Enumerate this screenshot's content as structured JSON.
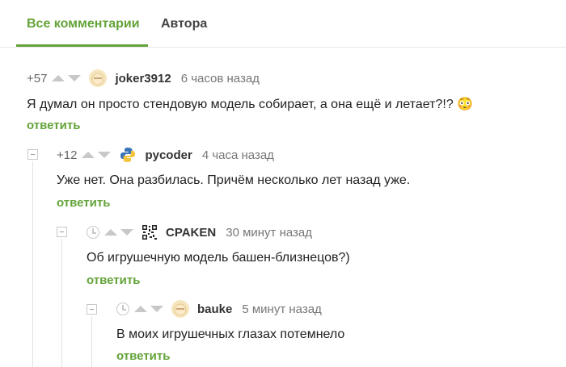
{
  "tabs": {
    "all": "Все комментарии",
    "authors": "Автора"
  },
  "accent_color": "#63a339",
  "comments": [
    {
      "rating": "+57",
      "username": "joker3912",
      "time": "6 часов назад",
      "text": "Я думал он просто стендовую модель собирает, а она ещё и летает?!? 😳",
      "reply": "ответить",
      "avatar_icon": "face-avatar-icon"
    },
    {
      "rating": "+12",
      "username": "pycoder",
      "time": "4 часа назад",
      "text": "Уже нет. Она разбилась. Причём несколько лет назад уже.",
      "reply": "ответить",
      "avatar_icon": "python-logo-icon"
    },
    {
      "username": "CPAKEN",
      "time": "30 минут назад",
      "text": "Об игрушечную модель башен-близнецов?)",
      "reply": "ответить",
      "avatar_icon": "qr-avatar-icon"
    },
    {
      "username": "bauke",
      "time": "5 минут назад",
      "text": "В моих игрушечных глазах потемнело",
      "reply": "ответить",
      "avatar_icon": "face-avatar-icon"
    }
  ]
}
